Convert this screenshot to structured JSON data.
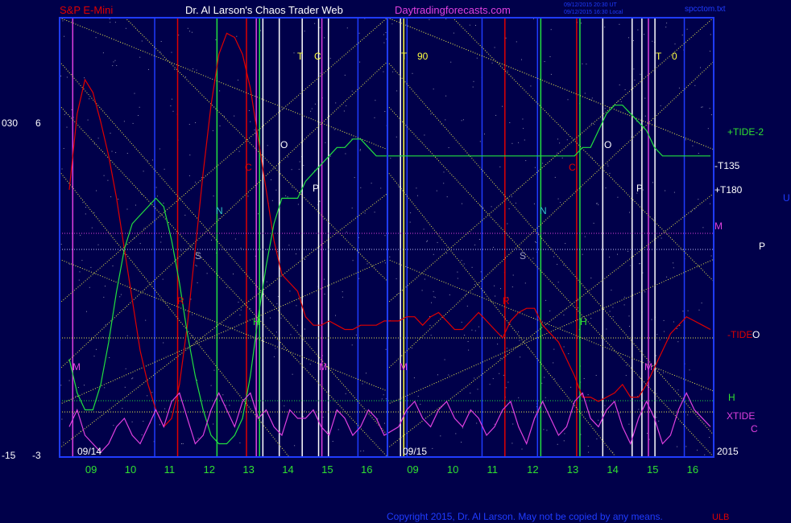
{
  "header": {
    "symbol": "S&P E-Mini",
    "title": "Dr. Al Larson's Chaos Trader Web",
    "site": "Daytradingforecasts.com",
    "stamp1": "09/12/2015 20:30 UT",
    "stamp2": "09/12/2015 16:30 Local",
    "file": "spcctom.txt"
  },
  "footer": {
    "copyright": "Copyright 2015, Dr. Al Larson. May not be copied by any means.",
    "corner": "ULB"
  },
  "colors": {
    "background": "#00004a",
    "frame": "#1f3cff",
    "red_line": "#e00000",
    "green_line": "#22e040",
    "magenta_line": "#e040e0",
    "white_line": "#ffffff",
    "yellow_dots": "#e8e850",
    "green_text": "#30e030",
    "cyan_text": "#30c8c8"
  },
  "chart_data": {
    "type": "line",
    "left_axis": {
      "top_labels": [
        "030",
        "6"
      ],
      "bottom_labels": [
        "-15",
        "-3"
      ]
    },
    "x_ticks": [
      "09",
      "10",
      "11",
      "12",
      "13",
      "14",
      "15",
      "16",
      "09",
      "10",
      "11",
      "12",
      "13",
      "14",
      "15",
      "16"
    ],
    "date_labels": [
      "09/14",
      "09/15",
      "2015"
    ],
    "annotations": [
      {
        "text": "T",
        "color": "#ffff40"
      },
      {
        "text": "C",
        "color": "#ffff40"
      },
      {
        "text": "T",
        "color": "#ffff40"
      },
      {
        "text": "90",
        "color": "#ffff40"
      },
      {
        "text": "T",
        "color": "#ffff40"
      },
      {
        "text": "0",
        "color": "#ffff40"
      },
      {
        "text": "O",
        "color": "#ffffff"
      },
      {
        "text": "O",
        "color": "#ffffff"
      },
      {
        "text": "P",
        "color": "#ffffff"
      },
      {
        "text": "P",
        "color": "#ffffff"
      },
      {
        "text": "C",
        "color": "#e00000"
      },
      {
        "text": "C",
        "color": "#e00000"
      },
      {
        "text": "N",
        "color": "#30c8c8"
      },
      {
        "text": "N",
        "color": "#30c8c8"
      },
      {
        "text": "S",
        "color": "#a0a0c0"
      },
      {
        "text": "S",
        "color": "#a0a0c0"
      },
      {
        "text": "R",
        "color": "#e00000"
      },
      {
        "text": "R",
        "color": "#e00000"
      },
      {
        "text": "H",
        "color": "#30e030"
      },
      {
        "text": "H",
        "color": "#30e030"
      },
      {
        "text": "M",
        "color": "#e040e0"
      },
      {
        "text": "M",
        "color": "#e040e0"
      },
      {
        "text": "M",
        "color": "#e040e0"
      },
      {
        "text": "M",
        "color": "#e040e0"
      }
    ],
    "right_labels": [
      {
        "text": "+TIDE-2",
        "color": "#30e030"
      },
      {
        "text": "-T135",
        "color": "#ffffff"
      },
      {
        "text": "+T180",
        "color": "#ffffff"
      },
      {
        "text": "M",
        "color": "#e040e0"
      },
      {
        "text": "P",
        "color": "#ffffff"
      },
      {
        "text": "-TIDE",
        "color": "#e00000"
      },
      {
        "text": "O",
        "color": "#ffffff"
      },
      {
        "text": "H",
        "color": "#30e030"
      },
      {
        "text": "XTIDE",
        "color": "#e040e0"
      },
      {
        "text": "C",
        "color": "#e040e0"
      },
      {
        "text": "U",
        "color": "#1f3cff"
      }
    ],
    "series": [
      {
        "name": "-TIDE",
        "color": "#e00000",
        "x": [
          0,
          0.2,
          0.4,
          0.6,
          0.8,
          1.0,
          1.2,
          1.4,
          1.6,
          1.8,
          2.0,
          2.2,
          2.4,
          2.6,
          2.8,
          3.0,
          3.2,
          3.4,
          3.6,
          3.8,
          4.0,
          4.2,
          4.4,
          4.6,
          4.8,
          5.0,
          5.2,
          5.4,
          5.6,
          5.8,
          6.0,
          6.2,
          6.4,
          6.6,
          6.8,
          7.0,
          7.2,
          7.4,
          7.6,
          7.8,
          8.0,
          8.2,
          8.4,
          8.6,
          8.8,
          9.0,
          9.2,
          9.4,
          9.6,
          9.8,
          10.0,
          10.2,
          10.4,
          10.6,
          10.8,
          11.0,
          11.2,
          11.4,
          11.6,
          11.8,
          12.0,
          12.2,
          12.4,
          12.6,
          12.8,
          13.0,
          13.2,
          13.4,
          13.6,
          13.8,
          14.0,
          14.2,
          14.4,
          14.6,
          14.8,
          15.0,
          15.2,
          15.4,
          15.6,
          15.8,
          16.0
        ],
        "y": [
          62,
          80,
          88,
          85,
          78,
          70,
          60,
          48,
          36,
          24,
          16,
          10,
          6,
          8,
          16,
          30,
          48,
          66,
          82,
          94,
          99,
          98,
          94,
          86,
          74,
          62,
          50,
          42,
          40,
          38,
          32,
          30,
          30,
          31,
          30,
          29,
          29,
          30,
          30,
          30,
          31,
          31,
          32,
          32,
          30,
          32,
          33,
          31,
          29,
          29,
          31,
          33,
          31,
          29,
          27,
          31,
          33,
          34,
          34,
          30,
          28,
          26,
          22,
          18,
          13,
          13,
          12,
          13,
          14,
          16,
          13,
          13,
          16,
          20,
          24,
          28,
          30,
          32,
          31,
          30,
          29
        ]
      },
      {
        "name": "+TIDE-2",
        "color": "#22e040",
        "x": [
          0,
          0.2,
          0.4,
          0.6,
          0.8,
          1.0,
          1.2,
          1.4,
          1.6,
          1.8,
          2.0,
          2.2,
          2.4,
          2.6,
          2.8,
          3.0,
          3.2,
          3.4,
          3.6,
          3.8,
          4.0,
          4.2,
          4.4,
          4.6,
          4.8,
          5.0,
          5.2,
          5.4,
          5.6,
          5.8,
          6.0,
          6.2,
          6.4,
          6.6,
          6.8,
          7.0,
          7.2,
          7.4,
          7.6,
          7.8,
          8.0,
          8.2,
          8.4,
          8.6,
          8.8,
          9.0,
          9.2,
          9.4,
          9.6,
          9.8,
          10.0,
          10.2,
          10.4,
          10.6,
          10.8,
          11.0,
          11.2,
          11.4,
          11.6,
          11.8,
          12.0,
          12.2,
          12.4,
          12.6,
          12.8,
          13.0,
          13.2,
          13.4,
          13.6,
          13.8,
          14.0,
          14.2,
          14.4,
          14.6,
          14.8,
          15.0,
          15.2,
          15.4,
          15.6,
          15.8,
          16.0
        ],
        "y": [
          22,
          14,
          10,
          10,
          16,
          26,
          38,
          48,
          54,
          56,
          58,
          60,
          58,
          50,
          40,
          28,
          18,
          10,
          4,
          2,
          2,
          4,
          8,
          18,
          32,
          44,
          54,
          60,
          60,
          60,
          64,
          66,
          68,
          70,
          72,
          72,
          74,
          74,
          72,
          70,
          70,
          70,
          70,
          70,
          70,
          70,
          70,
          70,
          70,
          70,
          70,
          70,
          70,
          70,
          70,
          70,
          70,
          70,
          70,
          70,
          70,
          70,
          70,
          70,
          72,
          72,
          76,
          80,
          82,
          82,
          80,
          78,
          76,
          72,
          70,
          70,
          70,
          70,
          70,
          70,
          70
        ]
      },
      {
        "name": "XTIDE",
        "color": "#e040e0",
        "x": [
          0,
          0.2,
          0.4,
          0.6,
          0.8,
          1.0,
          1.2,
          1.4,
          1.6,
          1.8,
          2.0,
          2.2,
          2.4,
          2.6,
          2.8,
          3.0,
          3.2,
          3.4,
          3.6,
          3.8,
          4.0,
          4.2,
          4.4,
          4.6,
          4.8,
          5.0,
          5.2,
          5.4,
          5.6,
          5.8,
          6.0,
          6.2,
          6.4,
          6.6,
          6.8,
          7.0,
          7.2,
          7.4,
          7.6,
          7.8,
          8.0,
          8.2,
          8.4,
          8.6,
          8.8,
          9.0,
          9.2,
          9.4,
          9.6,
          9.8,
          10.0,
          10.2,
          10.4,
          10.6,
          10.8,
          11.0,
          11.2,
          11.4,
          11.6,
          11.8,
          12.0,
          12.2,
          12.4,
          12.6,
          12.8,
          13.0,
          13.2,
          13.4,
          13.6,
          13.8,
          14.0,
          14.2,
          14.4,
          14.6,
          14.8,
          15.0,
          15.2,
          15.4,
          15.6,
          15.8,
          16.0
        ],
        "y": [
          6,
          10,
          4,
          2,
          0,
          2,
          6,
          8,
          4,
          2,
          6,
          10,
          6,
          12,
          14,
          8,
          2,
          4,
          10,
          14,
          10,
          6,
          12,
          14,
          8,
          10,
          6,
          4,
          10,
          8,
          8,
          10,
          6,
          4,
          10,
          8,
          4,
          6,
          10,
          8,
          4,
          6,
          10,
          12,
          8,
          6,
          10,
          12,
          8,
          6,
          10,
          8,
          4,
          6,
          10,
          12,
          6,
          2,
          8,
          12,
          8,
          4,
          6,
          12,
          14,
          8,
          6,
          10,
          12,
          6,
          2,
          8,
          12,
          8,
          2,
          4,
          10,
          14,
          10,
          8,
          6
        ]
      }
    ]
  }
}
